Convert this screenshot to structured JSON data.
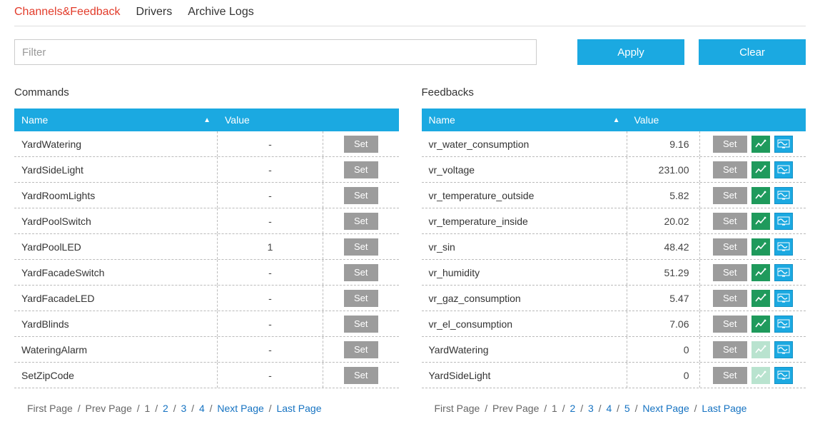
{
  "tabs": [
    {
      "label": "Channels&Feedback",
      "active": true
    },
    {
      "label": "Drivers",
      "active": false
    },
    {
      "label": "Archive Logs",
      "active": false
    }
  ],
  "filter": {
    "placeholder": "Filter"
  },
  "apply_label": "Apply",
  "clear_label": "Clear",
  "commands": {
    "title": "Commands",
    "headers": {
      "name": "Name",
      "value": "Value"
    },
    "set_label": "Set",
    "rows": [
      {
        "name": "YardWatering",
        "value": "-"
      },
      {
        "name": "YardSideLight",
        "value": "-"
      },
      {
        "name": "YardRoomLights",
        "value": "-"
      },
      {
        "name": "YardPoolSwitch",
        "value": "-"
      },
      {
        "name": "YardPoolLED",
        "value": "1"
      },
      {
        "name": "YardFacadeSwitch",
        "value": "-"
      },
      {
        "name": "YardFacadeLED",
        "value": "-"
      },
      {
        "name": "YardBlinds",
        "value": "-"
      },
      {
        "name": "WateringAlarm",
        "value": "-"
      },
      {
        "name": "SetZipCode",
        "value": "-"
      }
    ],
    "pager": {
      "first": "First Page",
      "prev": "Prev Page",
      "pages": [
        "1",
        "2",
        "3",
        "4"
      ],
      "next": "Next Page",
      "last": "Last Page",
      "active_from": 2
    }
  },
  "feedbacks": {
    "title": "Feedbacks",
    "headers": {
      "name": "Name",
      "value": "Value"
    },
    "set_label": "Set",
    "rows": [
      {
        "name": "vr_water_consumption",
        "value": "9.16",
        "chart_enabled": true
      },
      {
        "name": "vr_voltage",
        "value": "231.00",
        "chart_enabled": true
      },
      {
        "name": "vr_temperature_outside",
        "value": "5.82",
        "chart_enabled": true
      },
      {
        "name": "vr_temperature_inside",
        "value": "20.02",
        "chart_enabled": true
      },
      {
        "name": "vr_sin",
        "value": "48.42",
        "chart_enabled": true
      },
      {
        "name": "vr_humidity",
        "value": "51.29",
        "chart_enabled": true
      },
      {
        "name": "vr_gaz_consumption",
        "value": "5.47",
        "chart_enabled": true
      },
      {
        "name": "vr_el_consumption",
        "value": "7.06",
        "chart_enabled": true
      },
      {
        "name": "YardWatering",
        "value": "0",
        "chart_enabled": false
      },
      {
        "name": "YardSideLight",
        "value": "0",
        "chart_enabled": false
      }
    ],
    "pager": {
      "first": "First Page",
      "prev": "Prev Page",
      "pages": [
        "1",
        "2",
        "3",
        "4",
        "5"
      ],
      "next": "Next Page",
      "last": "Last Page",
      "active_from": 2
    }
  },
  "colors": {
    "accent_blue": "#1ba9e1",
    "accent_red": "#e23b2a",
    "green": "#1f9a5c",
    "gray_btn": "#9c9c9c"
  }
}
